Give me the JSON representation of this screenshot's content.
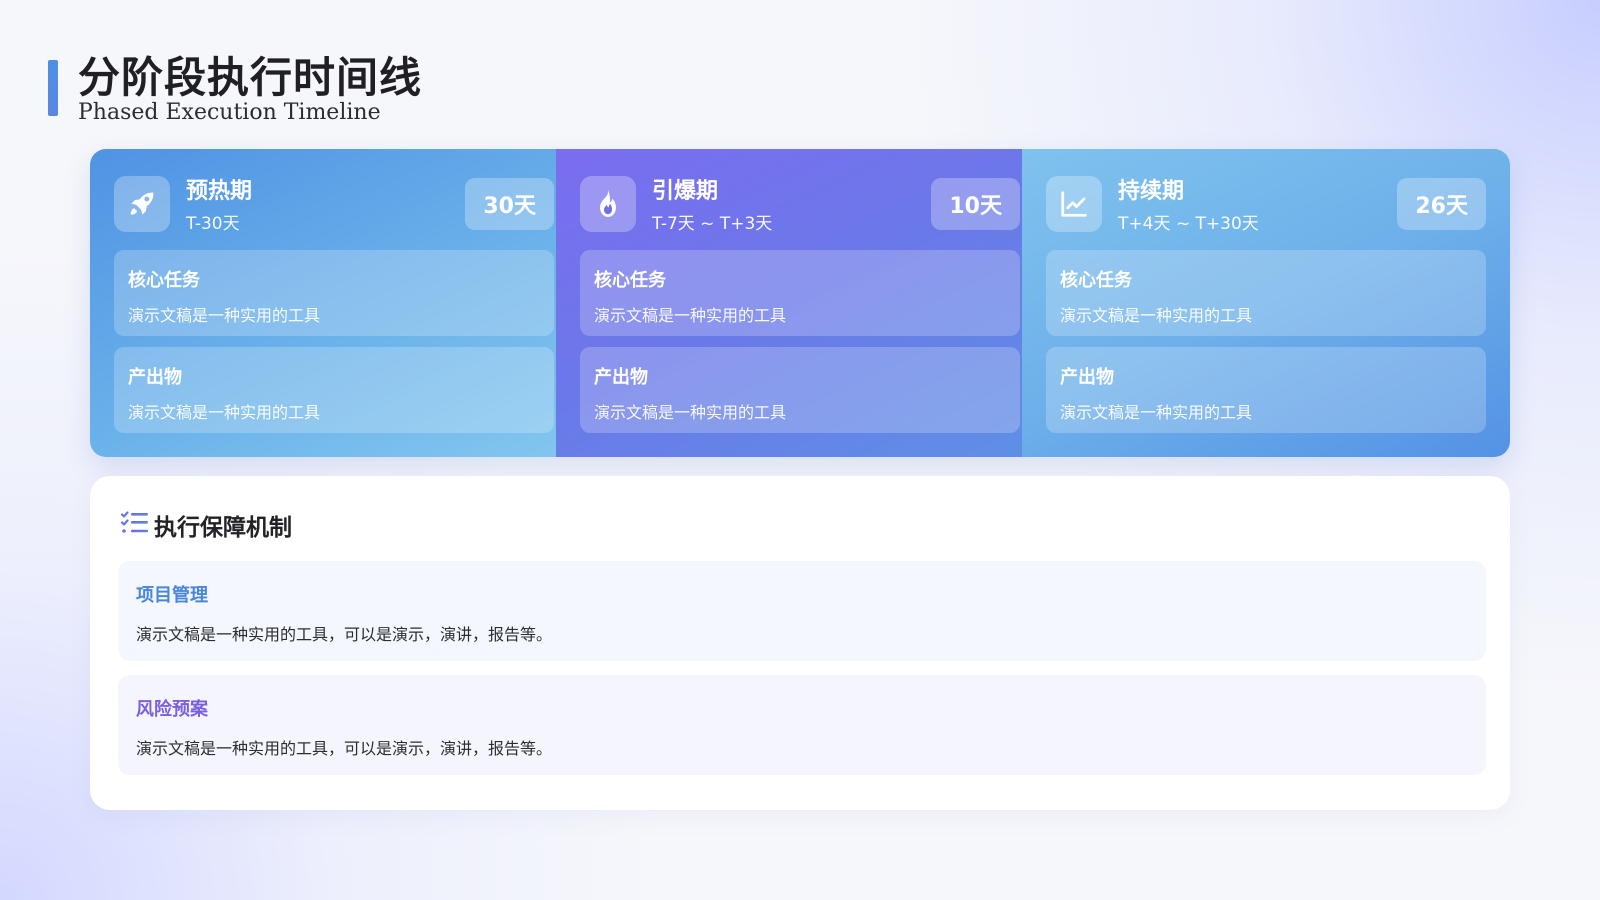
{
  "header": {
    "title": "分阶段执行时间线",
    "subtitle": "Phased Execution Timeline"
  },
  "phases": [
    {
      "icon": "rocket-icon",
      "name": "预热期",
      "range": "T-30天",
      "days": "30天",
      "boxes": [
        {
          "label": "核心任务",
          "text": "演示文稿是一种实用的工具"
        },
        {
          "label": "产出物",
          "text": "演示文稿是一种实用的工具"
        }
      ]
    },
    {
      "icon": "fire-icon",
      "name": "引爆期",
      "range": "T-7天 ~ T+3天",
      "days": "10天",
      "boxes": [
        {
          "label": "核心任务",
          "text": "演示文稿是一种实用的工具"
        },
        {
          "label": "产出物",
          "text": "演示文稿是一种实用的工具"
        }
      ]
    },
    {
      "icon": "line-chart-icon",
      "name": "持续期",
      "range": "T+4天 ~ T+30天",
      "days": "26天",
      "boxes": [
        {
          "label": "核心任务",
          "text": "演示文稿是一种实用的工具"
        },
        {
          "label": "产出物",
          "text": "演示文稿是一种实用的工具"
        }
      ]
    }
  ],
  "guarantee": {
    "icon": "checklist-icon",
    "title": "执行保障机制",
    "items": [
      {
        "label": "项目管理",
        "text": "演示文稿是一种实用的工具，可以是演示，演讲，报告等。"
      },
      {
        "label": "风险预案",
        "text": "演示文稿是一种实用的工具，可以是演示，演讲，报告等。"
      }
    ]
  },
  "colors": {
    "accent_blue": "#4e8fe6",
    "accent_purple": "#7b5fe0",
    "phase_1": "#5a9fe6",
    "phase_2": "#7070ec",
    "phase_3": "#6db0ea"
  }
}
